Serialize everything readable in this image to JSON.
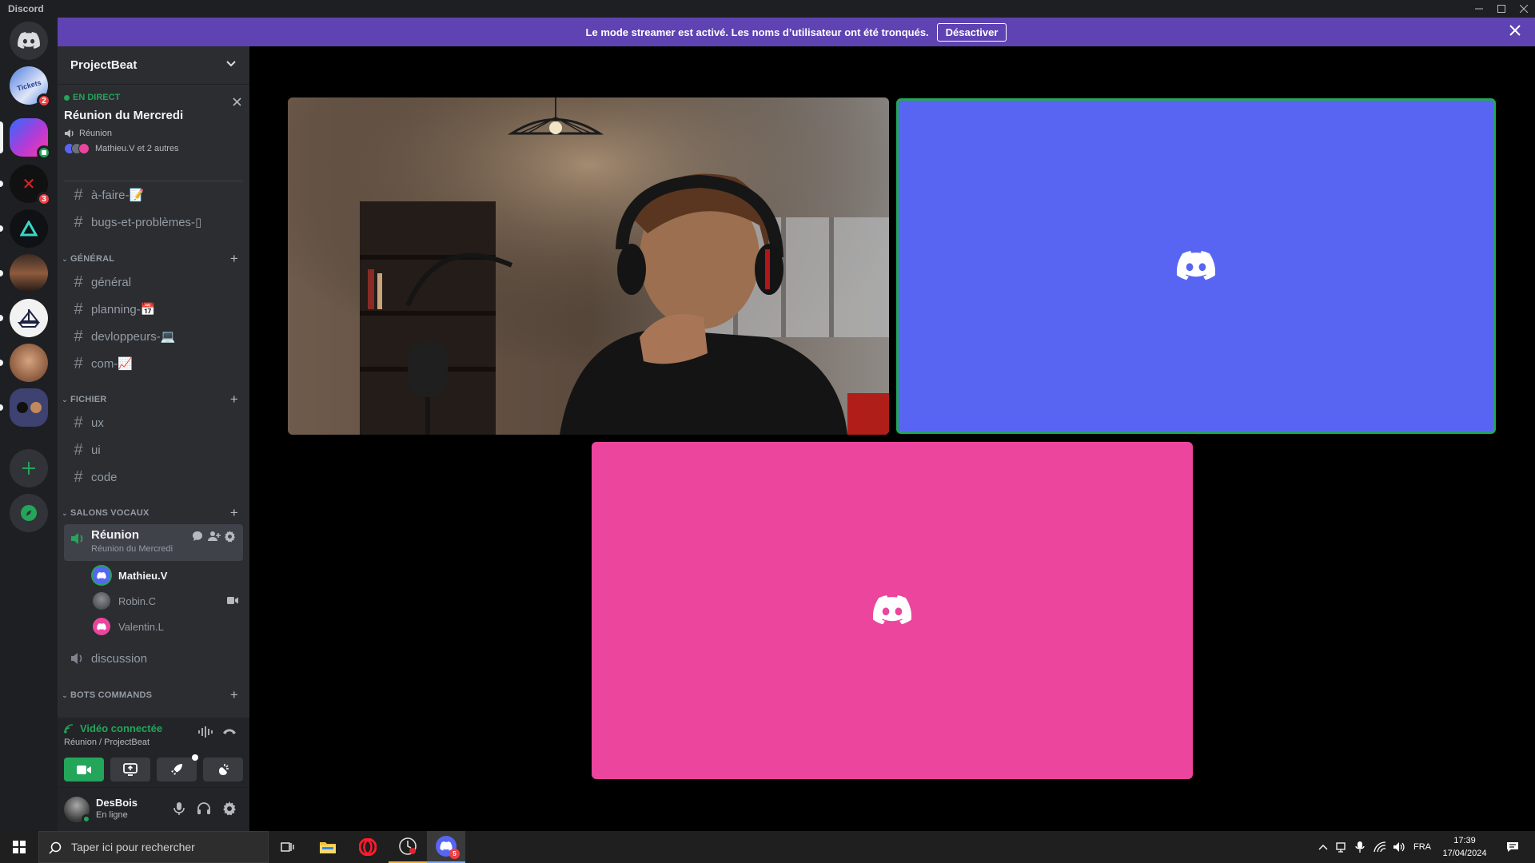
{
  "window": {
    "app_name": "Discord"
  },
  "banner": {
    "message": "Le mode streamer est activé. Les noms d’utilisateur ont été tronqués.",
    "button_label": "Désactiver"
  },
  "server_rail": {
    "badges": [
      "2",
      "3"
    ]
  },
  "sidebar": {
    "server_name": "ProjectBeat",
    "live": {
      "tag": "EN DIRECT",
      "title": "Réunion du Mercredi",
      "channel": "Réunion",
      "participants": "Mathieu.V et 2 autres"
    },
    "top_channels": [
      "à-faire-📝",
      "bugs-et-problèmes-▯"
    ],
    "categories": {
      "general": {
        "label": "GÉNÉRAL",
        "channels": [
          "général",
          "planning-📅",
          "devloppeurs-💻",
          "com-📈"
        ]
      },
      "fichier": {
        "label": "FICHIER",
        "channels": [
          "ux",
          "ui",
          "code"
        ]
      },
      "salons_vocaux": {
        "label": "SALONS VOCAUX"
      },
      "bots": {
        "label": "BOTS COMMANDS"
      }
    },
    "voice_channel": {
      "name": "Réunion",
      "subtitle": "Réunion du Mercredi",
      "users": [
        "Mathieu.V",
        "Robin.C",
        "Valentin.L"
      ],
      "other": "discussion"
    }
  },
  "voice_panel": {
    "status": "Vidéo connectée",
    "location": "Réunion / ProjectBeat"
  },
  "user_panel": {
    "username": "DesBois",
    "status": "En ligne"
  },
  "colors": {
    "blurple": "#5865f2",
    "pink": "#eb459e",
    "green": "#23a55a",
    "banner": "#5f43b2"
  },
  "taskbar": {
    "search_placeholder": "Taper ici pour rechercher",
    "language": "FRA",
    "time": "17:39",
    "date": "17/04/2024",
    "discord_badge": "5"
  }
}
